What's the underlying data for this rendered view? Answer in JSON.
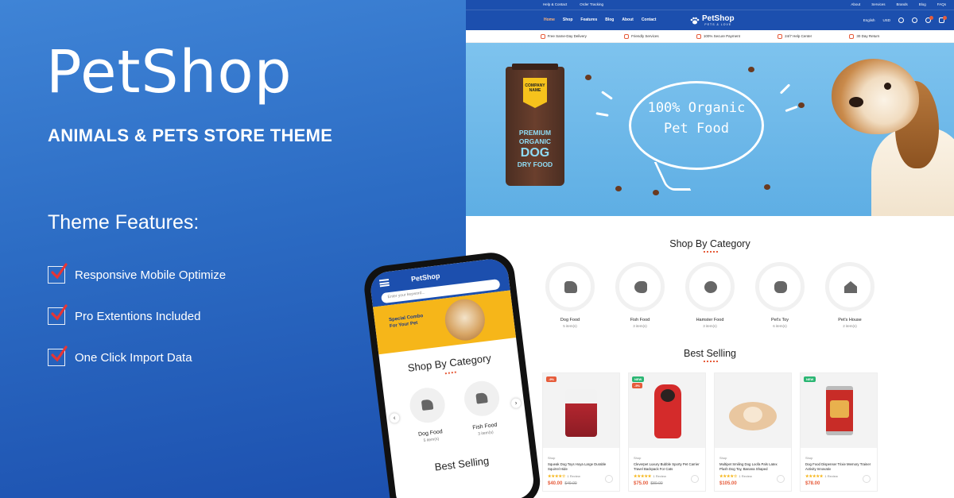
{
  "promo": {
    "brand": "PetShop",
    "tagline": "ANIMALS & PETS STORE THEME",
    "features_title": "Theme Features:",
    "features": [
      "Responsive Mobile Optimize",
      "Pro Extentions Included",
      "One Click Import Data"
    ],
    "bg_top": "#3f84d6",
    "bg_bottom": "#1c4fae",
    "check_color": "#e63535"
  },
  "phone": {
    "logo": "PetShop",
    "search_placeholder": "Enter your keyword...",
    "banner_text": "Special Combo For Your Pet",
    "shop_title": "Shop By Category",
    "categories": [
      {
        "name": "Dog Food",
        "count": "5 item(s)"
      },
      {
        "name": "Fish Food",
        "count": "3 item(s)"
      }
    ],
    "best_title": "Best Selling"
  },
  "site": {
    "topbar_left": [
      "Help & Contact",
      "Order Tracking"
    ],
    "topbar_right": [
      "About",
      "Services",
      "Brands",
      "Blog",
      "FAQs"
    ],
    "nav": [
      "Home",
      "Shop",
      "Features",
      "Blog",
      "About",
      "Contact"
    ],
    "logo": "PetShop",
    "logo_sub": "PETS & LOVE",
    "language": "English",
    "currency": "USD",
    "services": [
      "Free Same-Day Delivery",
      "Friendly Services",
      "100% Secure Payment",
      "24/7 Help Center",
      "30 Day Return"
    ],
    "hero": {
      "bag_label": "COMPANY NAME",
      "bag_line1": "PREMIUM",
      "bag_line2": "ORGANIC",
      "bag_line3": "DOG",
      "bag_line4": "DRY FOOD",
      "bubble_line1": "100% Organic",
      "bubble_line2": "Pet Food"
    },
    "shop_title": "Shop By Category",
    "categories": [
      {
        "name": "Dog Food",
        "count": "5 item(s)"
      },
      {
        "name": "Fish Food",
        "count": "3 item(s)"
      },
      {
        "name": "Hamster Food",
        "count": "3 item(s)"
      },
      {
        "name": "Pet's Toy",
        "count": "6 item(s)"
      },
      {
        "name": "Pet's House",
        "count": "2 item(s)"
      }
    ],
    "best_title": "Best Selling",
    "products": [
      {
        "badge": "-9%",
        "badge_color": "#e65c3b",
        "badge2": "",
        "category": "Shop",
        "name": "Squeak Dog Toys Hoya Large Durable Squirrel Hide",
        "stars": "★★★★☆",
        "reviews": "1 Review",
        "price": "$40.00",
        "old_price": "$49.00"
      },
      {
        "badge": "NEW",
        "badge_color": "#2bb673",
        "badge2": "-9%",
        "category": "Shop",
        "name": "Cleverpet Luxury Bubble Sporty Pet Carrier Travel Backpack For Cats",
        "stars": "★★★★★",
        "reviews": "1 Review",
        "price": "$75.00",
        "old_price": "$80.00"
      },
      {
        "badge": "",
        "badge_color": "#2bb673",
        "badge2": "",
        "category": "Shop",
        "name": "Multipet Smiling Dog Loofa Pals Latex Plush Dog Toy, Banana Shaped",
        "stars": "★★★★☆",
        "reviews": "1 Review",
        "price": "$105.00",
        "old_price": ""
      },
      {
        "badge": "NEW",
        "badge_color": "#2bb673",
        "badge2": "",
        "category": "Shop",
        "name": "Dog Food Dispenser Trixie Memory Trainer Activity Innovativ",
        "stars": "★★★★★",
        "reviews": "1 Review",
        "price": "$78.00",
        "old_price": ""
      }
    ]
  },
  "colors": {
    "primary": "#1c4fae",
    "accent": "#e65c3b"
  }
}
